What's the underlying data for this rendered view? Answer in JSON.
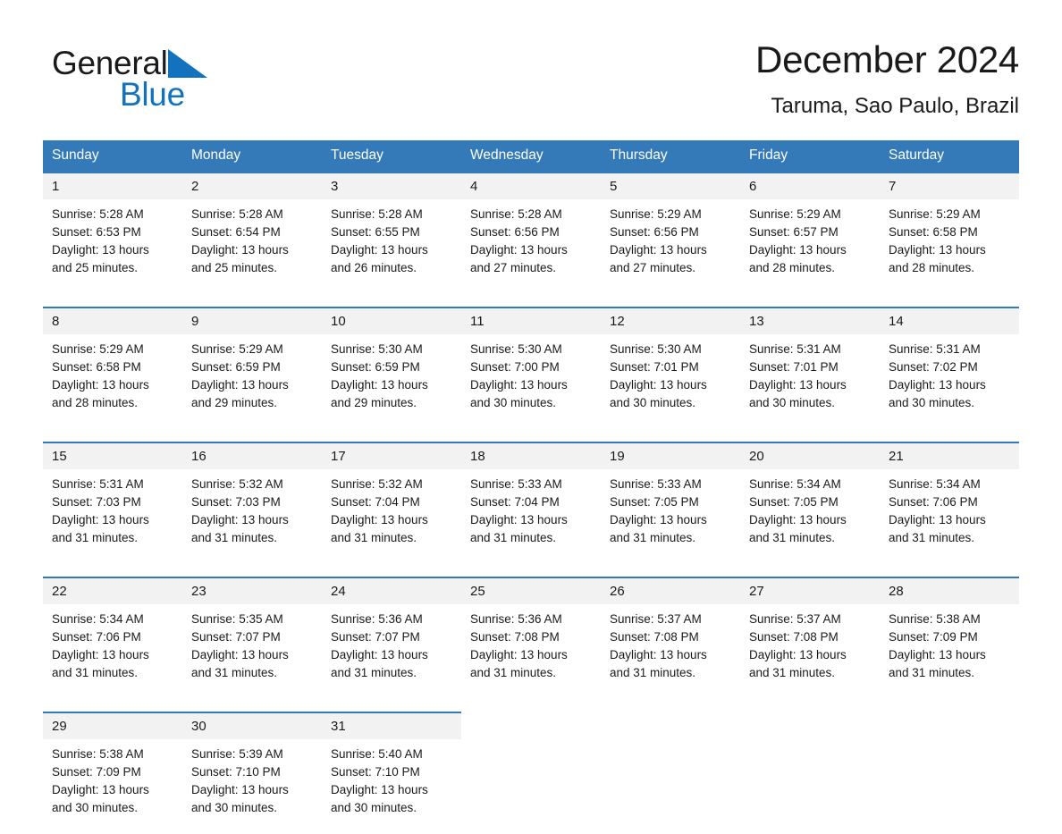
{
  "brand": {
    "name_part1": "General",
    "name_part2": "Blue",
    "triangle_color": "#1272bd"
  },
  "header": {
    "month_title": "December 2024",
    "location": "Taruma, Sao Paulo, Brazil"
  },
  "theme": {
    "header_blue": "#3479b8",
    "row_divider_blue": "#3479b8",
    "daynum_bg": "#f2f2f2"
  },
  "calendar": {
    "weekday_headers": [
      "Sunday",
      "Monday",
      "Tuesday",
      "Wednesday",
      "Thursday",
      "Friday",
      "Saturday"
    ],
    "weeks": [
      [
        {
          "day": "1",
          "sunrise": "Sunrise: 5:28 AM",
          "sunset": "Sunset: 6:53 PM",
          "daylight_1": "Daylight: 13 hours",
          "daylight_2": "and 25 minutes."
        },
        {
          "day": "2",
          "sunrise": "Sunrise: 5:28 AM",
          "sunset": "Sunset: 6:54 PM",
          "daylight_1": "Daylight: 13 hours",
          "daylight_2": "and 25 minutes."
        },
        {
          "day": "3",
          "sunrise": "Sunrise: 5:28 AM",
          "sunset": "Sunset: 6:55 PM",
          "daylight_1": "Daylight: 13 hours",
          "daylight_2": "and 26 minutes."
        },
        {
          "day": "4",
          "sunrise": "Sunrise: 5:28 AM",
          "sunset": "Sunset: 6:56 PM",
          "daylight_1": "Daylight: 13 hours",
          "daylight_2": "and 27 minutes."
        },
        {
          "day": "5",
          "sunrise": "Sunrise: 5:29 AM",
          "sunset": "Sunset: 6:56 PM",
          "daylight_1": "Daylight: 13 hours",
          "daylight_2": "and 27 minutes."
        },
        {
          "day": "6",
          "sunrise": "Sunrise: 5:29 AM",
          "sunset": "Sunset: 6:57 PM",
          "daylight_1": "Daylight: 13 hours",
          "daylight_2": "and 28 minutes."
        },
        {
          "day": "7",
          "sunrise": "Sunrise: 5:29 AM",
          "sunset": "Sunset: 6:58 PM",
          "daylight_1": "Daylight: 13 hours",
          "daylight_2": "and 28 minutes."
        }
      ],
      [
        {
          "day": "8",
          "sunrise": "Sunrise: 5:29 AM",
          "sunset": "Sunset: 6:58 PM",
          "daylight_1": "Daylight: 13 hours",
          "daylight_2": "and 28 minutes."
        },
        {
          "day": "9",
          "sunrise": "Sunrise: 5:29 AM",
          "sunset": "Sunset: 6:59 PM",
          "daylight_1": "Daylight: 13 hours",
          "daylight_2": "and 29 minutes."
        },
        {
          "day": "10",
          "sunrise": "Sunrise: 5:30 AM",
          "sunset": "Sunset: 6:59 PM",
          "daylight_1": "Daylight: 13 hours",
          "daylight_2": "and 29 minutes."
        },
        {
          "day": "11",
          "sunrise": "Sunrise: 5:30 AM",
          "sunset": "Sunset: 7:00 PM",
          "daylight_1": "Daylight: 13 hours",
          "daylight_2": "and 30 minutes."
        },
        {
          "day": "12",
          "sunrise": "Sunrise: 5:30 AM",
          "sunset": "Sunset: 7:01 PM",
          "daylight_1": "Daylight: 13 hours",
          "daylight_2": "and 30 minutes."
        },
        {
          "day": "13",
          "sunrise": "Sunrise: 5:31 AM",
          "sunset": "Sunset: 7:01 PM",
          "daylight_1": "Daylight: 13 hours",
          "daylight_2": "and 30 minutes."
        },
        {
          "day": "14",
          "sunrise": "Sunrise: 5:31 AM",
          "sunset": "Sunset: 7:02 PM",
          "daylight_1": "Daylight: 13 hours",
          "daylight_2": "and 30 minutes."
        }
      ],
      [
        {
          "day": "15",
          "sunrise": "Sunrise: 5:31 AM",
          "sunset": "Sunset: 7:03 PM",
          "daylight_1": "Daylight: 13 hours",
          "daylight_2": "and 31 minutes."
        },
        {
          "day": "16",
          "sunrise": "Sunrise: 5:32 AM",
          "sunset": "Sunset: 7:03 PM",
          "daylight_1": "Daylight: 13 hours",
          "daylight_2": "and 31 minutes."
        },
        {
          "day": "17",
          "sunrise": "Sunrise: 5:32 AM",
          "sunset": "Sunset: 7:04 PM",
          "daylight_1": "Daylight: 13 hours",
          "daylight_2": "and 31 minutes."
        },
        {
          "day": "18",
          "sunrise": "Sunrise: 5:33 AM",
          "sunset": "Sunset: 7:04 PM",
          "daylight_1": "Daylight: 13 hours",
          "daylight_2": "and 31 minutes."
        },
        {
          "day": "19",
          "sunrise": "Sunrise: 5:33 AM",
          "sunset": "Sunset: 7:05 PM",
          "daylight_1": "Daylight: 13 hours",
          "daylight_2": "and 31 minutes."
        },
        {
          "day": "20",
          "sunrise": "Sunrise: 5:34 AM",
          "sunset": "Sunset: 7:05 PM",
          "daylight_1": "Daylight: 13 hours",
          "daylight_2": "and 31 minutes."
        },
        {
          "day": "21",
          "sunrise": "Sunrise: 5:34 AM",
          "sunset": "Sunset: 7:06 PM",
          "daylight_1": "Daylight: 13 hours",
          "daylight_2": "and 31 minutes."
        }
      ],
      [
        {
          "day": "22",
          "sunrise": "Sunrise: 5:34 AM",
          "sunset": "Sunset: 7:06 PM",
          "daylight_1": "Daylight: 13 hours",
          "daylight_2": "and 31 minutes."
        },
        {
          "day": "23",
          "sunrise": "Sunrise: 5:35 AM",
          "sunset": "Sunset: 7:07 PM",
          "daylight_1": "Daylight: 13 hours",
          "daylight_2": "and 31 minutes."
        },
        {
          "day": "24",
          "sunrise": "Sunrise: 5:36 AM",
          "sunset": "Sunset: 7:07 PM",
          "daylight_1": "Daylight: 13 hours",
          "daylight_2": "and 31 minutes."
        },
        {
          "day": "25",
          "sunrise": "Sunrise: 5:36 AM",
          "sunset": "Sunset: 7:08 PM",
          "daylight_1": "Daylight: 13 hours",
          "daylight_2": "and 31 minutes."
        },
        {
          "day": "26",
          "sunrise": "Sunrise: 5:37 AM",
          "sunset": "Sunset: 7:08 PM",
          "daylight_1": "Daylight: 13 hours",
          "daylight_2": "and 31 minutes."
        },
        {
          "day": "27",
          "sunrise": "Sunrise: 5:37 AM",
          "sunset": "Sunset: 7:08 PM",
          "daylight_1": "Daylight: 13 hours",
          "daylight_2": "and 31 minutes."
        },
        {
          "day": "28",
          "sunrise": "Sunrise: 5:38 AM",
          "sunset": "Sunset: 7:09 PM",
          "daylight_1": "Daylight: 13 hours",
          "daylight_2": "and 31 minutes."
        }
      ],
      [
        {
          "day": "29",
          "sunrise": "Sunrise: 5:38 AM",
          "sunset": "Sunset: 7:09 PM",
          "daylight_1": "Daylight: 13 hours",
          "daylight_2": "and 30 minutes."
        },
        {
          "day": "30",
          "sunrise": "Sunrise: 5:39 AM",
          "sunset": "Sunset: 7:10 PM",
          "daylight_1": "Daylight: 13 hours",
          "daylight_2": "and 30 minutes."
        },
        {
          "day": "31",
          "sunrise": "Sunrise: 5:40 AM",
          "sunset": "Sunset: 7:10 PM",
          "daylight_1": "Daylight: 13 hours",
          "daylight_2": "and 30 minutes."
        },
        null,
        null,
        null,
        null
      ]
    ]
  }
}
